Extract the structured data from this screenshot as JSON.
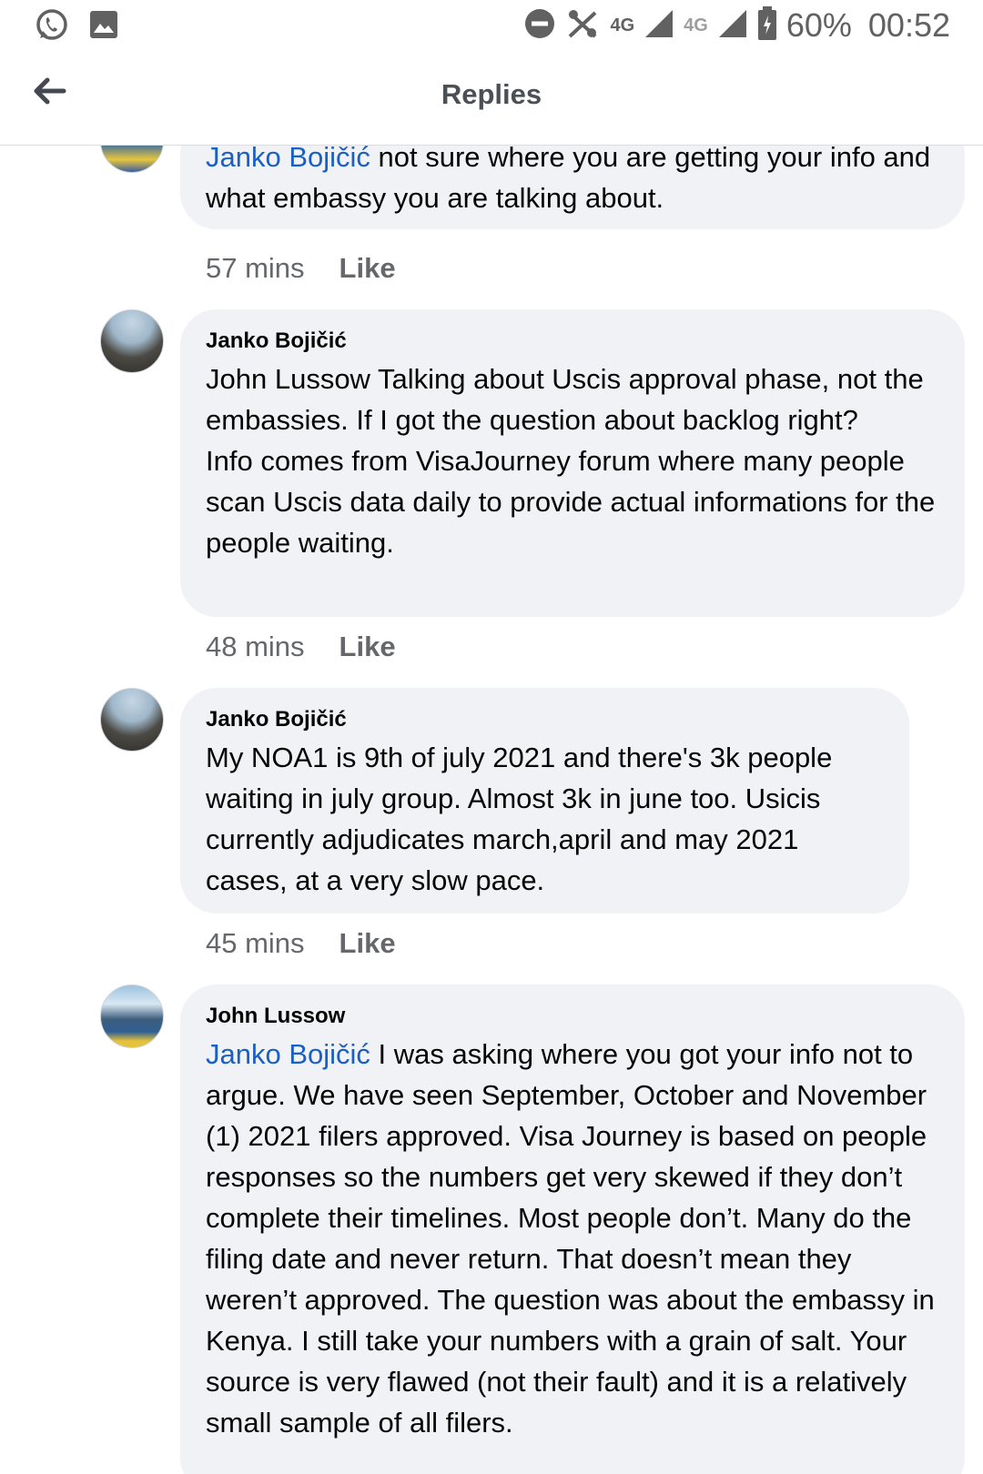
{
  "status_bar": {
    "network_1": "4G",
    "network_2": "4G",
    "battery": "60%",
    "time": "00:52"
  },
  "header": {
    "title": "Replies"
  },
  "comments": [
    {
      "mention": "Janko Bojičić",
      "text": " not sure where you are getting your info and what embassy you are talking about.",
      "time": "57 mins",
      "like": "Like"
    },
    {
      "author": "Janko Bojičić",
      "text": "John Lussow Talking about Uscis approval phase, not the embassies. If I got the question about backlog right?\nInfo comes from VisaJourney forum where many people scan Uscis data daily to provide actual informations for the people waiting.",
      "time": "48 mins",
      "like": "Like"
    },
    {
      "author": "Janko Bojičić",
      "text": "My NOA1 is 9th of july 2021 and there's 3k people waiting in july group. Almost 3k in june too. Usicis currently adjudicates march,april and may 2021 cases, at a very slow pace.",
      "time": "45 mins",
      "like": "Like"
    },
    {
      "author": "John Lussow",
      "mention": "Janko Bojičić",
      "text": "  I was asking where you got your info not to argue. We have seen September, October and November (1) 2021 filers approved. Visa Journey is based on people responses so the numbers get very skewed if they don’t complete their timelines. Most people don’t. Many do the filing date and never return. That doesn’t mean they weren’t approved. The question was about the embassy in Kenya.  I still take your numbers with a grain of salt. Your source is very flawed (not their fault) and it is a relatively small sample of all filers."
    }
  ],
  "colors": {
    "bubble": "#f0f2f5",
    "mention": "#1a5fc4",
    "meta": "#65676b"
  }
}
